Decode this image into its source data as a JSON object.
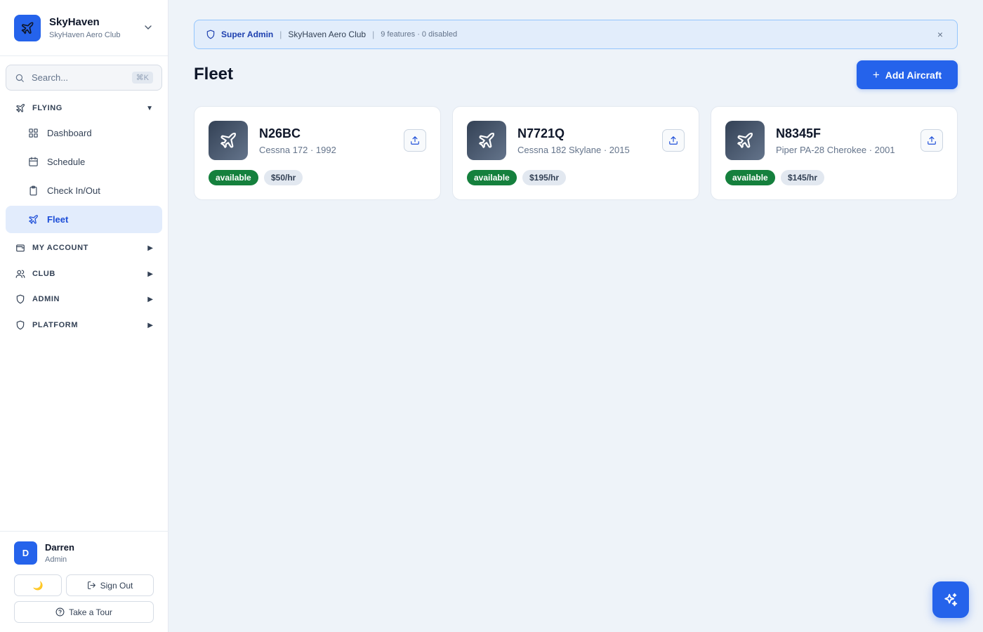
{
  "brand": {
    "name": "SkyHaven",
    "subtitle": "SkyHaven Aero Club"
  },
  "search": {
    "placeholder": "Search...",
    "shortcut": "⌘K"
  },
  "nav": {
    "flying": {
      "label": "FLYING",
      "items": [
        {
          "label": "Dashboard",
          "icon": "grid-icon"
        },
        {
          "label": "Schedule",
          "icon": "calendar-icon"
        },
        {
          "label": "Check In/Out",
          "icon": "clipboard-icon"
        },
        {
          "label": "Fleet",
          "icon": "plane-icon",
          "active": true
        }
      ]
    },
    "my_account": {
      "label": "MY ACCOUNT"
    },
    "club": {
      "label": "CLUB"
    },
    "admin": {
      "label": "ADMIN"
    },
    "platform": {
      "label": "PLATFORM"
    }
  },
  "user": {
    "initial": "D",
    "name": "Darren",
    "role": "Admin"
  },
  "footer": {
    "theme_icon": "🌙",
    "sign_out": "Sign Out",
    "tour": "Take a Tour"
  },
  "banner": {
    "role": "Super Admin",
    "club": "SkyHaven Aero Club",
    "stats": "9 features · 0 disabled",
    "close": "×"
  },
  "page": {
    "title": "Fleet",
    "add_button": "Add Aircraft",
    "add_icon": "+"
  },
  "aircraft": [
    {
      "tail": "N26BC",
      "model": "Cessna 172 · 1992",
      "status": "available",
      "rate": "$50/hr"
    },
    {
      "tail": "N7721Q",
      "model": "Cessna 182 Skylane · 2015",
      "status": "available",
      "rate": "$195/hr"
    },
    {
      "tail": "N8345F",
      "model": "Piper PA-28 Cherokee · 2001",
      "status": "available",
      "rate": "$145/hr"
    }
  ],
  "colors": {
    "accent": "#2563eb",
    "status_available": "#15803d",
    "banner_bg": "#e2edfb"
  }
}
